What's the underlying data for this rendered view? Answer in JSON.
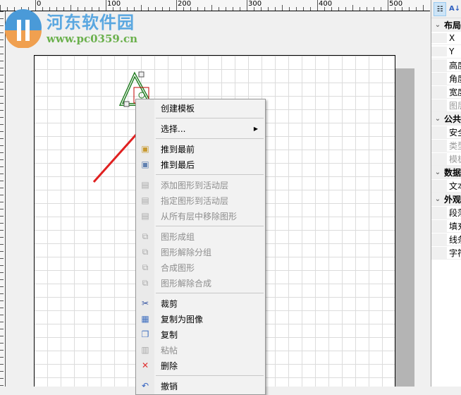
{
  "ruler": {
    "labels": [
      "0",
      "100",
      "200",
      "300",
      "400",
      "500"
    ]
  },
  "watermark": {
    "title": "河东软件园",
    "url": "www.pc0359.cn"
  },
  "menu": {
    "items": [
      {
        "label": "创建模板",
        "icon": "none",
        "disabled": false
      },
      {
        "sep": true
      },
      {
        "label": "选择...",
        "icon": "none",
        "disabled": false,
        "submenu": true
      },
      {
        "sep": true
      },
      {
        "label": "推到最前",
        "icon": "bring-to-front-icon",
        "disabled": false
      },
      {
        "label": "推到最后",
        "icon": "send-to-back-icon",
        "disabled": false
      },
      {
        "sep": true
      },
      {
        "label": "添加图形到活动层",
        "icon": "layer-add-icon",
        "disabled": true
      },
      {
        "label": "指定图形到活动层",
        "icon": "layer-assign-icon",
        "disabled": true
      },
      {
        "label": "从所有层中移除图形",
        "icon": "layer-remove-icon",
        "disabled": true
      },
      {
        "sep": true
      },
      {
        "label": "图形成组",
        "icon": "group-icon",
        "disabled": true
      },
      {
        "label": "图形解除分组",
        "icon": "ungroup-icon",
        "disabled": true
      },
      {
        "label": "合成图形",
        "icon": "combine-icon",
        "disabled": true
      },
      {
        "label": "图形解除合成",
        "icon": "uncombine-icon",
        "disabled": true
      },
      {
        "sep": true
      },
      {
        "label": "裁剪",
        "icon": "cut-icon",
        "disabled": false
      },
      {
        "label": "复制为图像",
        "icon": "copy-as-image-icon",
        "disabled": false
      },
      {
        "label": "复制",
        "icon": "copy-icon",
        "disabled": false
      },
      {
        "label": "粘帖",
        "icon": "paste-icon",
        "disabled": true
      },
      {
        "label": "删除",
        "icon": "delete-icon",
        "disabled": false
      },
      {
        "sep": true
      },
      {
        "label": "撤销",
        "icon": "undo-icon",
        "disabled": false
      }
    ]
  },
  "panel": {
    "rows": [
      {
        "cat": true,
        "label": "布局"
      },
      {
        "label": "X"
      },
      {
        "label": "Y"
      },
      {
        "label": "高度"
      },
      {
        "label": "角度"
      },
      {
        "label": "宽度"
      },
      {
        "label": "图层",
        "disabled": true
      },
      {
        "cat": true,
        "label": "公共"
      },
      {
        "label": "安全"
      },
      {
        "label": "类型",
        "disabled": true
      },
      {
        "label": "模板",
        "disabled": true
      },
      {
        "cat": true,
        "label": "数据"
      },
      {
        "label": "文本"
      },
      {
        "cat": true,
        "label": "外观"
      },
      {
        "label": "段落"
      },
      {
        "label": "填充"
      },
      {
        "label": "线条"
      },
      {
        "label": "字符"
      }
    ]
  },
  "colors": {
    "shape": "#1e7a1e",
    "arrow": "#e02020",
    "selection": "#c00000"
  }
}
